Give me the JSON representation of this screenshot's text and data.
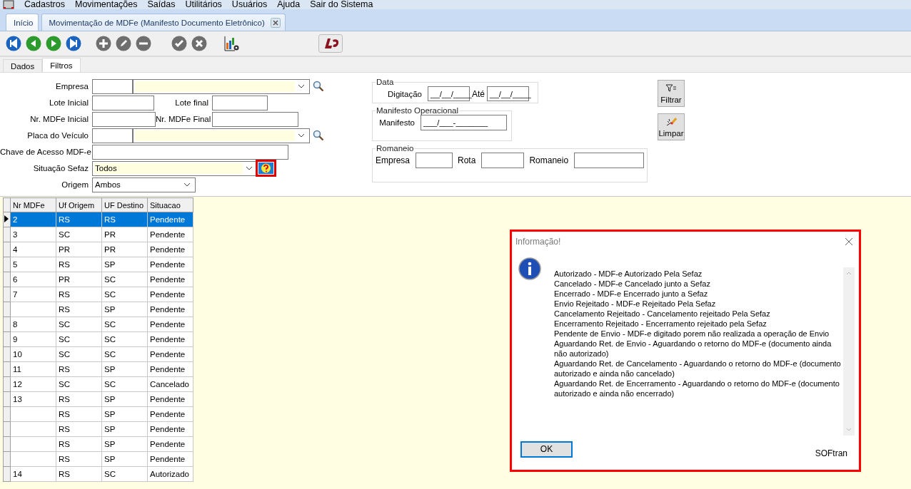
{
  "menu": [
    "Cadastros",
    "Movimentações",
    "Saídas",
    "Utilitários",
    "Usuários",
    "Ajuda",
    "Sair do Sistema"
  ],
  "tabs": [
    {
      "label": "Início",
      "selected": true,
      "closable": false
    },
    {
      "label": "Movimentação de MDFe (Manifesto Documento Eletrônico)",
      "selected": false,
      "closable": true
    }
  ],
  "sub_tabs": [
    {
      "label": "Dados",
      "selected": false
    },
    {
      "label": "Filtros",
      "selected": true
    }
  ],
  "filters": {
    "empresa": {
      "label": "Empresa"
    },
    "lote_inicial": {
      "label": "Lote Inicial"
    },
    "lote_final": {
      "label": "Lote final"
    },
    "nr_inicial": {
      "label": "Nr. MDFe Inicial"
    },
    "nr_final": {
      "label": "Nr. MDFe Final"
    },
    "placa": {
      "label": "Placa do Veículo"
    },
    "chave": {
      "label": "Chave de Acesso MDF-e"
    },
    "situacao": {
      "label": "Situação Sefaz",
      "value": "Todos"
    },
    "origem": {
      "label": "Origem",
      "value": "Ambos"
    }
  },
  "data_group": {
    "title": "Data",
    "label": "Digitação",
    "from": "__/__/____",
    "to_label": "Até",
    "to": "__/__/____"
  },
  "manifesto_group": {
    "title": "Manifesto Operacional",
    "label": "Manifesto",
    "value": "___/___-_______"
  },
  "romaneio_group": {
    "title": "Romaneio",
    "fields": [
      "Empresa",
      "Rota",
      "Romaneio"
    ]
  },
  "action_buttons": [
    {
      "label": "Filtrar",
      "kind": "filter"
    },
    {
      "label": "Limpar",
      "kind": "clear"
    }
  ],
  "table": {
    "columns": [
      "Nr MDFe",
      "Uf Origem",
      "UF Destino",
      "Situacao"
    ],
    "rows": [
      {
        "nr": "2",
        "origem": "RS",
        "destino": "RS",
        "situacao": "Pendente",
        "selected": true
      },
      {
        "nr": "3",
        "origem": "SC",
        "destino": "PR",
        "situacao": "Pendente",
        "selected": false
      },
      {
        "nr": "4",
        "origem": "PR",
        "destino": "PR",
        "situacao": "Pendente",
        "selected": false
      },
      {
        "nr": "5",
        "origem": "RS",
        "destino": "SP",
        "situacao": "Pendente",
        "selected": false
      },
      {
        "nr": "6",
        "origem": "PR",
        "destino": "SC",
        "situacao": "Pendente",
        "selected": false
      },
      {
        "nr": "7",
        "origem": "RS",
        "destino": "SC",
        "situacao": "Pendente",
        "selected": false
      },
      {
        "origem": "RS",
        "destino": "SP",
        "situacao": "Pendente",
        "selected": false
      },
      {
        "nr": "8",
        "origem": "SC",
        "destino": "SC",
        "situacao": "Pendente",
        "selected": false
      },
      {
        "nr": "9",
        "origem": "SC",
        "destino": "SC",
        "situacao": "Pendente",
        "selected": false
      },
      {
        "nr": "10",
        "origem": "SC",
        "destino": "SC",
        "situacao": "Pendente",
        "selected": false
      },
      {
        "nr": "11",
        "origem": "RS",
        "destino": "SP",
        "situacao": "Pendente",
        "selected": false
      },
      {
        "nr": "12",
        "origem": "SC",
        "destino": "SC",
        "situacao": "Cancelado",
        "selected": false
      },
      {
        "nr": "13",
        "origem": "RS",
        "destino": "SP",
        "situacao": "Pendente",
        "selected": false
      },
      {
        "origem": "RS",
        "destino": "SP",
        "situacao": "Pendente",
        "selected": false
      },
      {
        "origem": "RS",
        "destino": "SP",
        "situacao": "Pendente",
        "selected": false
      },
      {
        "origem": "RS",
        "destino": "SP",
        "situacao": "Pendente",
        "selected": false
      },
      {
        "origem": "RS",
        "destino": "SP",
        "situacao": "Pendente",
        "selected": false
      },
      {
        "nr": "14",
        "origem": "RS",
        "destino": "SC",
        "situacao": "Autorizado",
        "selected": false
      }
    ]
  },
  "dialog": {
    "title": "Informação!",
    "lines": [
      "Autorizado - MDF-e Autorizado Pela Sefaz",
      "Cancelado - MDF-e Cancelado junto a Sefaz",
      "Encerrado - MDF-e Encerrado junto a Sefaz",
      "Envio Rejeitado - MDF-e Rejeitado Pela Sefaz",
      "Cancelamento Rejeitado - Cancelamento rejeitado Pela Sefaz",
      "Encerramento Rejeitado - Encerramento rejeitado pela Sefaz",
      "Pendente de Envio - MDF-e digitado porem não realizada a operação de Envio",
      "Aguardando Ret. de Envio - Aguardando o retorno do MDF-e (documento ainda não autorizado)",
      "Aguardando Ret. de Cancelamento - Aguardando o retorno do MDF-e (documento autorizado e ainda não cancelado)",
      "Aguardando Ret. de Encerramento - Aguardando o retorno do MDF-e (documento autorizado e ainda não encerrado)"
    ],
    "ok": "OK",
    "brand": "SOFtran"
  }
}
